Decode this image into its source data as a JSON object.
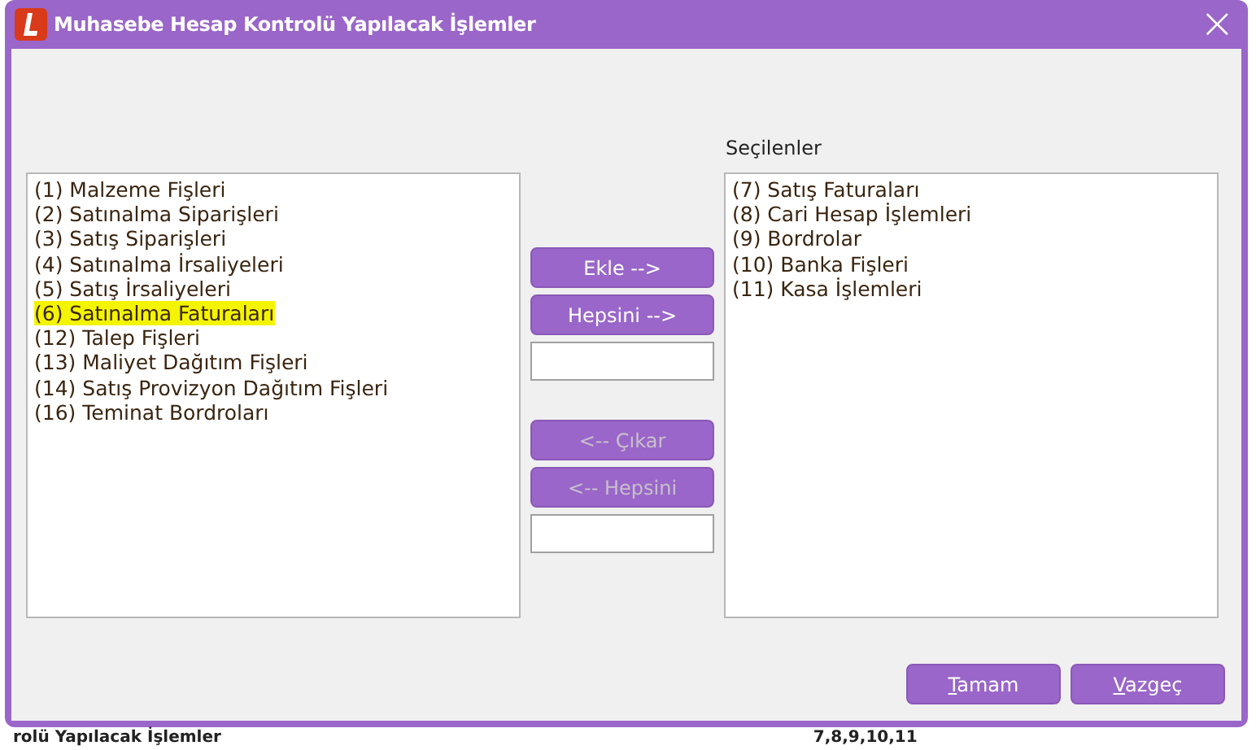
{
  "window": {
    "title": "Muhasebe Hesap Kontrolü Yapılacak İşlemler",
    "close": "×"
  },
  "available": {
    "items": [
      {
        "label": "(1) Malzeme Fişleri",
        "highlighted": false
      },
      {
        "label": "(2) Satınalma Siparişleri",
        "highlighted": false
      },
      {
        "label": "(3) Satış Siparişleri",
        "highlighted": false
      },
      {
        "label": "(4) Satınalma İrsaliyeleri",
        "highlighted": false
      },
      {
        "label": "(5) Satış İrsaliyeleri",
        "highlighted": false
      },
      {
        "label": "(6) Satınalma Faturaları",
        "highlighted": true
      },
      {
        "label": "(12) Talep Fişleri",
        "highlighted": false
      },
      {
        "label": "(13) Maliyet Dağıtım Fişleri",
        "highlighted": false
      },
      {
        "label": "(14) Satış Provizyon Dağıtım Fişleri",
        "highlighted": false
      },
      {
        "label": "(16) Teminat Bordroları",
        "highlighted": false
      }
    ]
  },
  "add_buttons": [
    {
      "label": "Ekle -->",
      "disabled": false
    },
    {
      "label": "Hepsini -->",
      "disabled": false
    }
  ],
  "remove_buttons": [
    {
      "label": "<-- Çıkar",
      "disabled": true
    },
    {
      "label": "<-- Hepsini",
      "disabled": true
    }
  ],
  "selected": {
    "title": "Seçilenler",
    "items": [
      {
        "label": "(7) Satış Faturaları"
      },
      {
        "label": "(8) Cari Hesap İşlemleri"
      },
      {
        "label": "(9) Bordrolar"
      },
      {
        "label": "(10) Banka Fişleri"
      },
      {
        "label": "(11) Kasa İşlemleri"
      }
    ]
  },
  "footer_buttons": [
    {
      "accesskey": "T",
      "label_rest": "amam"
    },
    {
      "accesskey": "V",
      "label_rest": "azgeç"
    }
  ],
  "background": {
    "text": "rolü Yapılacak İşlemler",
    "value": "7,8,9,10,11"
  }
}
